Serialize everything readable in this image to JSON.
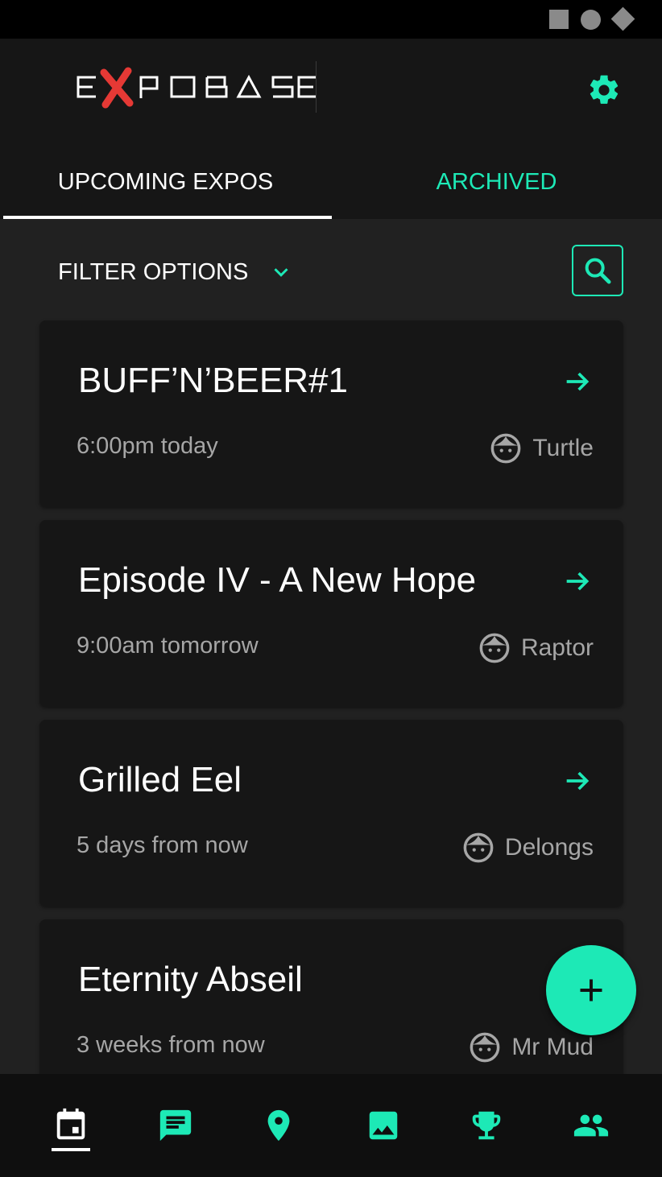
{
  "app": {
    "logo_text": "EXPOBASE",
    "accent_color": "#1de9b6",
    "logo_x_color": "#e53935"
  },
  "tabs": [
    {
      "label": "UPCOMING EXPOS",
      "active": true
    },
    {
      "label": "ARCHIVED",
      "active": false
    }
  ],
  "filter": {
    "label": "FILTER OPTIONS"
  },
  "expos": [
    {
      "title": "BUFF’N’BEER#1",
      "time": "6:00pm today",
      "host": "Turtle"
    },
    {
      "title": "Episode IV - A New Hope",
      "time": "9:00am tomorrow",
      "host": "Raptor"
    },
    {
      "title": "Grilled Eel",
      "time": "5 days from now",
      "host": "Delongs"
    },
    {
      "title": "Eternity Abseil",
      "time": "3 weeks from now",
      "host": "Mr Mud"
    }
  ],
  "bottom_nav": [
    {
      "icon": "calendar-icon",
      "active": true
    },
    {
      "icon": "chat-icon",
      "active": false
    },
    {
      "icon": "location-pin-icon",
      "active": false
    },
    {
      "icon": "image-icon",
      "active": false
    },
    {
      "icon": "trophy-icon",
      "active": false
    },
    {
      "icon": "people-icon",
      "active": false
    }
  ],
  "fab": {
    "icon": "plus-icon"
  }
}
